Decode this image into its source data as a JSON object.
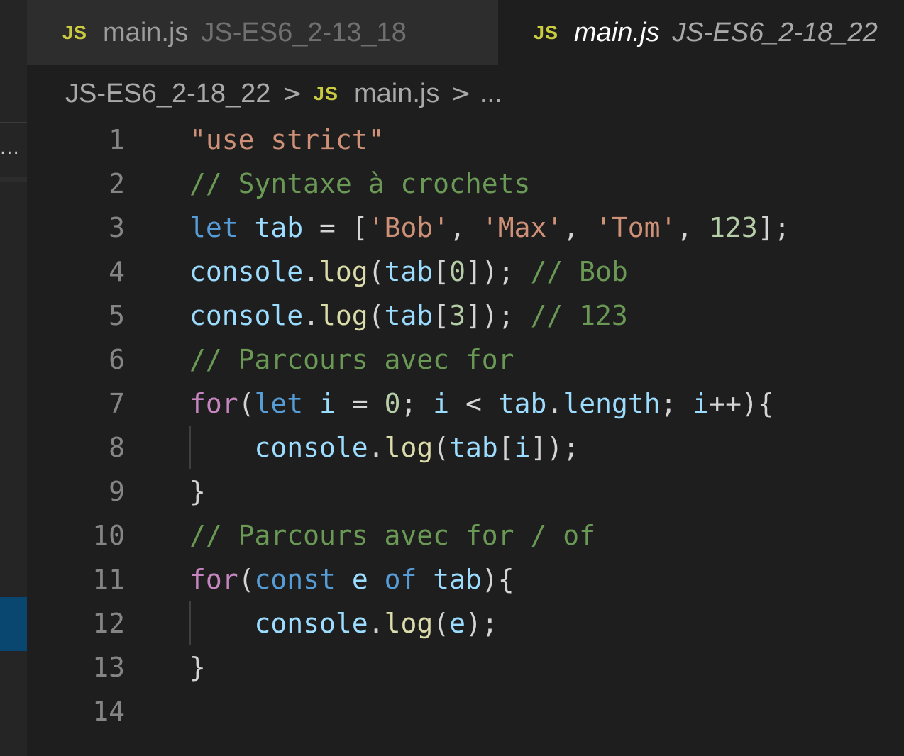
{
  "tabs": [
    {
      "icon": "JS",
      "name": "main.js",
      "description": "JS-ES6_2-13_18",
      "active": false
    },
    {
      "icon": "JS",
      "name": "main.js",
      "description": "JS-ES6_2-18_22",
      "active": true
    }
  ],
  "sidebar": {
    "overflow_label": "..."
  },
  "breadcrumb": {
    "folder": "JS-ES6_2-18_22",
    "sep": ">",
    "file_icon": "JS",
    "file": "main.js",
    "symbol": "..."
  },
  "editor": {
    "lines": [
      {
        "n": "1",
        "tokens": [
          {
            "t": "\"use strict\"",
            "c": "c-str"
          }
        ]
      },
      {
        "n": "2",
        "tokens": [
          {
            "t": "// Syntaxe à crochets",
            "c": "c-com"
          }
        ]
      },
      {
        "n": "3",
        "tokens": [
          {
            "t": "let",
            "c": "c-kw"
          },
          {
            "t": " ",
            "c": "c-punc"
          },
          {
            "t": "tab",
            "c": "c-var"
          },
          {
            "t": " = [",
            "c": "c-punc"
          },
          {
            "t": "'Bob'",
            "c": "c-str"
          },
          {
            "t": ", ",
            "c": "c-punc"
          },
          {
            "t": "'Max'",
            "c": "c-str"
          },
          {
            "t": ", ",
            "c": "c-punc"
          },
          {
            "t": "'Tom'",
            "c": "c-str"
          },
          {
            "t": ", ",
            "c": "c-punc"
          },
          {
            "t": "123",
            "c": "c-num"
          },
          {
            "t": "];",
            "c": "c-punc"
          }
        ]
      },
      {
        "n": "4",
        "tokens": [
          {
            "t": "console",
            "c": "c-var"
          },
          {
            "t": ".",
            "c": "c-punc"
          },
          {
            "t": "log",
            "c": "c-fn"
          },
          {
            "t": "(",
            "c": "c-punc"
          },
          {
            "t": "tab",
            "c": "c-var"
          },
          {
            "t": "[",
            "c": "c-punc"
          },
          {
            "t": "0",
            "c": "c-num"
          },
          {
            "t": "]); ",
            "c": "c-punc"
          },
          {
            "t": "// Bob",
            "c": "c-com"
          }
        ]
      },
      {
        "n": "5",
        "tokens": [
          {
            "t": "console",
            "c": "c-var"
          },
          {
            "t": ".",
            "c": "c-punc"
          },
          {
            "t": "log",
            "c": "c-fn"
          },
          {
            "t": "(",
            "c": "c-punc"
          },
          {
            "t": "tab",
            "c": "c-var"
          },
          {
            "t": "[",
            "c": "c-punc"
          },
          {
            "t": "3",
            "c": "c-num"
          },
          {
            "t": "]); ",
            "c": "c-punc"
          },
          {
            "t": "// 123",
            "c": "c-com"
          }
        ]
      },
      {
        "n": "6",
        "tokens": [
          {
            "t": "// Parcours avec for",
            "c": "c-com"
          }
        ]
      },
      {
        "n": "7",
        "tokens": [
          {
            "t": "for",
            "c": "c-ctl"
          },
          {
            "t": "(",
            "c": "c-punc"
          },
          {
            "t": "let",
            "c": "c-kw"
          },
          {
            "t": " ",
            "c": "c-punc"
          },
          {
            "t": "i",
            "c": "c-var"
          },
          {
            "t": " = ",
            "c": "c-punc"
          },
          {
            "t": "0",
            "c": "c-num"
          },
          {
            "t": "; ",
            "c": "c-punc"
          },
          {
            "t": "i",
            "c": "c-var"
          },
          {
            "t": " < ",
            "c": "c-punc"
          },
          {
            "t": "tab",
            "c": "c-var"
          },
          {
            "t": ".",
            "c": "c-punc"
          },
          {
            "t": "length",
            "c": "c-var"
          },
          {
            "t": "; ",
            "c": "c-punc"
          },
          {
            "t": "i",
            "c": "c-var"
          },
          {
            "t": "++){",
            "c": "c-punc"
          }
        ]
      },
      {
        "n": "8",
        "guide": true,
        "tokens": [
          {
            "t": "    ",
            "c": "c-punc"
          },
          {
            "t": "console",
            "c": "c-var"
          },
          {
            "t": ".",
            "c": "c-punc"
          },
          {
            "t": "log",
            "c": "c-fn"
          },
          {
            "t": "(",
            "c": "c-punc"
          },
          {
            "t": "tab",
            "c": "c-var"
          },
          {
            "t": "[",
            "c": "c-punc"
          },
          {
            "t": "i",
            "c": "c-var"
          },
          {
            "t": "]);",
            "c": "c-punc"
          }
        ]
      },
      {
        "n": "9",
        "tokens": [
          {
            "t": "}",
            "c": "c-punc"
          }
        ]
      },
      {
        "n": "10",
        "tokens": [
          {
            "t": "// Parcours avec for / of",
            "c": "c-com"
          }
        ]
      },
      {
        "n": "11",
        "tokens": [
          {
            "t": "for",
            "c": "c-ctl"
          },
          {
            "t": "(",
            "c": "c-punc"
          },
          {
            "t": "const",
            "c": "c-kw"
          },
          {
            "t": " ",
            "c": "c-punc"
          },
          {
            "t": "e",
            "c": "c-var"
          },
          {
            "t": " ",
            "c": "c-punc"
          },
          {
            "t": "of",
            "c": "c-kw"
          },
          {
            "t": " ",
            "c": "c-punc"
          },
          {
            "t": "tab",
            "c": "c-var"
          },
          {
            "t": "){",
            "c": "c-punc"
          }
        ]
      },
      {
        "n": "12",
        "guide": true,
        "tokens": [
          {
            "t": "    ",
            "c": "c-punc"
          },
          {
            "t": "console",
            "c": "c-var"
          },
          {
            "t": ".",
            "c": "c-punc"
          },
          {
            "t": "log",
            "c": "c-fn"
          },
          {
            "t": "(",
            "c": "c-punc"
          },
          {
            "t": "e",
            "c": "c-var"
          },
          {
            "t": ");",
            "c": "c-punc"
          }
        ]
      },
      {
        "n": "13",
        "tokens": [
          {
            "t": "}",
            "c": "c-punc"
          }
        ]
      },
      {
        "n": "14",
        "tokens": []
      }
    ]
  },
  "colors": {
    "editor_bg": "#1e1e1e",
    "tabbar_bg": "#252526",
    "js_icon": "#cbcb41",
    "selection_accent": "#094771"
  }
}
